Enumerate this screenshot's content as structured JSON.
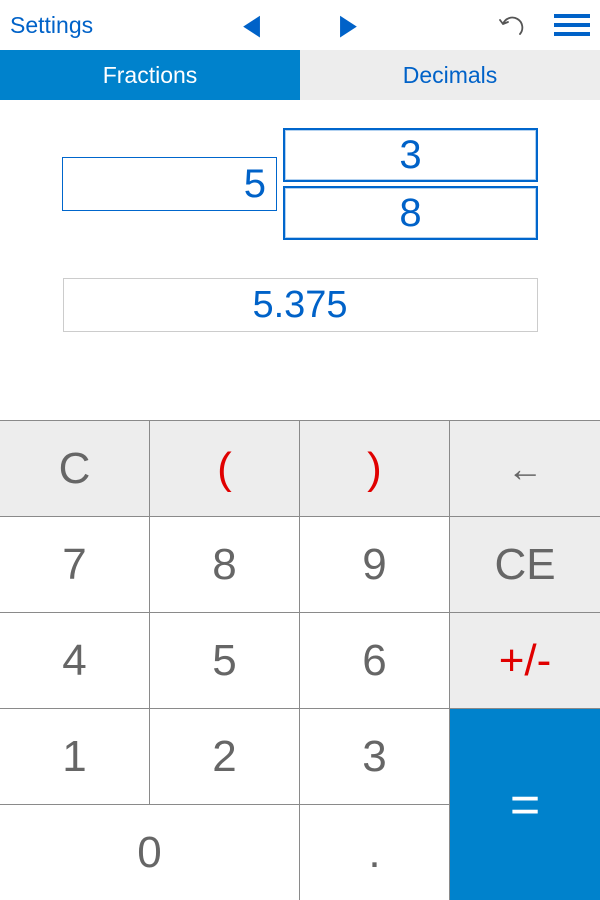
{
  "toolbar": {
    "settings_label": "Settings"
  },
  "tabs": {
    "fractions_label": "Fractions",
    "decimals_label": "Decimals"
  },
  "input": {
    "whole": "5",
    "numerator": "3",
    "denominator": "8",
    "result": "5.375"
  },
  "keypad": {
    "clear": "C",
    "paren_open": "(",
    "paren_close": ")",
    "backspace": "←",
    "k7": "7",
    "k8": "8",
    "k9": "9",
    "ce": "CE",
    "k4": "4",
    "k5": "5",
    "k6": "6",
    "sign": "+/-",
    "k1": "1",
    "k2": "2",
    "k3": "3",
    "k0": "0",
    "dot": ".",
    "eq": "="
  }
}
